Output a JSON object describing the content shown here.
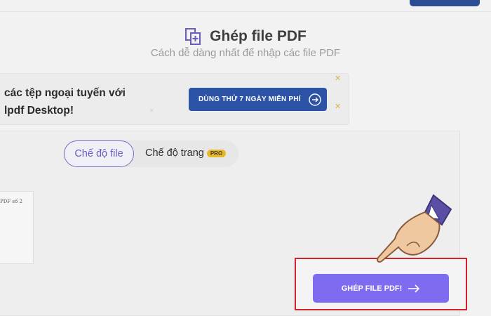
{
  "header": {
    "title": "Ghép file PDF",
    "subtitle": "Cách dễ dàng nhất để nhập các file PDF"
  },
  "promo": {
    "line1": "các tệp ngoại tuyến với",
    "line2": "lpdf Desktop!",
    "button_label": "DÙNG THỬ 7 NGÀY MIỄN PHÍ"
  },
  "modes": {
    "file_mode": "Chế độ file",
    "page_mode": "Chế độ trang",
    "pro_badge": "PRO"
  },
  "files": [
    {
      "name": "PDF số 2"
    }
  ],
  "action": {
    "merge_label": "GHÉP FILE PDF!"
  },
  "colors": {
    "brand_blue": "#2c53a6",
    "accent_purple": "#7e6cf0",
    "highlight_red": "#d2232a",
    "pro_yellow": "#e9b824"
  }
}
